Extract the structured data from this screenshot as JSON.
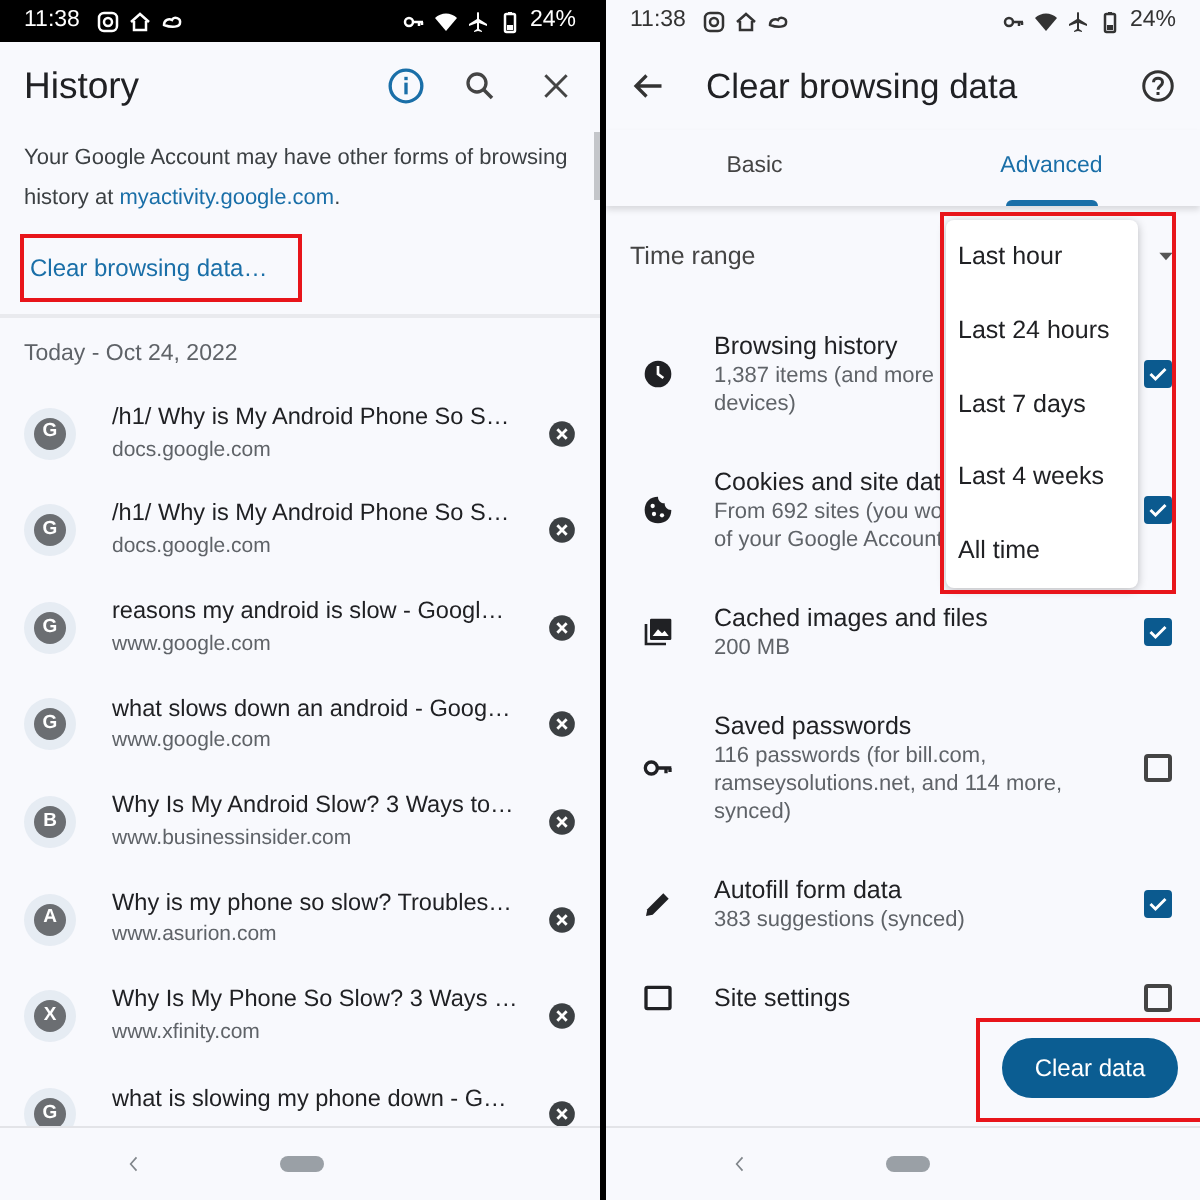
{
  "history_screen": {
    "status_bar": {
      "time": "11:38",
      "battery": "24%"
    },
    "title": "History",
    "notice": {
      "text": "Your Google Account may have other forms of browsing history at ",
      "link": "myactivity.google.com",
      "end": "."
    },
    "clear_link": {
      "label": "Clear browsing data…",
      "highlighted": true
    },
    "date_header": "Today - Oct 24, 2022",
    "items": [
      {
        "letter": "G",
        "title": "/h1/ Why is My Android Phone So S…",
        "url": "docs.google.com"
      },
      {
        "letter": "G",
        "title": "/h1/ Why is My Android Phone So S…",
        "url": "docs.google.com"
      },
      {
        "letter": "G",
        "title": "reasons my android is slow - Googl…",
        "url": "www.google.com"
      },
      {
        "letter": "G",
        "title": "what slows down an android - Goog…",
        "url": "www.google.com"
      },
      {
        "letter": "B",
        "title": "Why Is My Android Slow? 3 Ways to…",
        "url": "www.businessinsider.com"
      },
      {
        "letter": "A",
        "title": "Why is my phone so slow? Troubles…",
        "url": "www.asurion.com"
      },
      {
        "letter": "X",
        "title": "Why Is My Phone So Slow? 3 Ways …",
        "url": "www.xfinity.com"
      },
      {
        "letter": "G",
        "title": "what is slowing my phone down - G…"
      }
    ]
  },
  "clear_screen": {
    "status_bar": {
      "time": "11:38",
      "battery": "24%"
    },
    "title": "Clear browsing data",
    "tabs": [
      {
        "label": "Basic",
        "selected": false
      },
      {
        "label": "Advanced",
        "selected": true
      }
    ],
    "time_range": {
      "label": "Time range",
      "menu_highlighted": true,
      "options": [
        "Last hour",
        "Last 24 hours",
        "Last 7 days",
        "Last 4 weeks",
        "All time"
      ]
    },
    "items": [
      {
        "kind": "clock",
        "title": "Browsing history",
        "lines": [
          "1,387 items (and more",
          "devices)"
        ],
        "checked": true
      },
      {
        "kind": "cookie",
        "title": "Cookies and site dat",
        "lines": [
          "From 692 sites (you wo",
          "of your Google Account"
        ],
        "checked": true
      },
      {
        "kind": "images",
        "title": "Cached images and files",
        "lines": [
          "200 MB"
        ],
        "checked": true
      },
      {
        "kind": "key",
        "title": "Saved passwords",
        "lines": [
          "116 passwords (for bill.com,",
          "ramseysolutions.net, and 114 more,",
          "synced)"
        ],
        "checked": false
      },
      {
        "kind": "pencil",
        "title": "Autofill form data",
        "lines": [
          "383 suggestions (synced)"
        ],
        "checked": true
      },
      {
        "kind": "window",
        "title": "Site settings",
        "checked": false
      }
    ],
    "clear_button": {
      "label": "Clear data",
      "highlighted": true
    }
  }
}
